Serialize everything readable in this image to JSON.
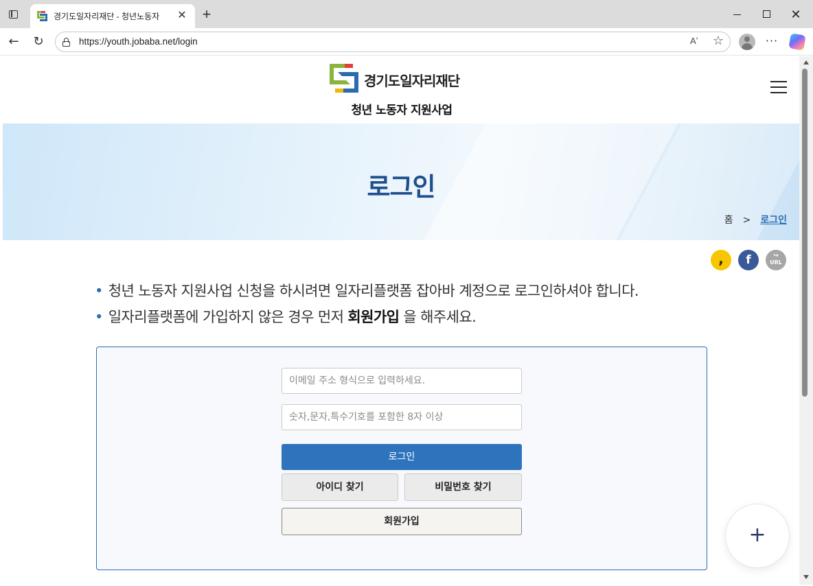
{
  "browser": {
    "tab_title": "경기도일자리재단 - 청년노동자",
    "tab_close": "✕",
    "new_tab": "+",
    "url": "https://youth.jobaba.net/login",
    "read_aloud": "Aʽ",
    "more": "···",
    "window_close": "✕"
  },
  "header": {
    "logo_text": "경기도일자리재단",
    "subtitle": "청년 노동자 지원사업"
  },
  "banner": {
    "title": "로그인",
    "breadcrumb": {
      "home": "홈",
      "separator": ">",
      "current": "로그인"
    }
  },
  "share": {
    "kakao": ",",
    "facebook": "f",
    "url": "URL"
  },
  "notices": {
    "line1": "청년 노동자 지원사업 신청을 하시려면 일자리플랫폼 잡아바 계정으로 로그인하셔야 합니다.",
    "line2_before": "일자리플랫폼에 가입하지 않은 경우 먼저 ",
    "line2_link": "회원가입",
    "line2_after": " 을 해주세요.",
    "bullet": "•"
  },
  "login_form": {
    "email_placeholder": "이메일 주소 형식으로 입력하세요.",
    "password_placeholder": "숫자,문자,특수기호를 포함한 8자 이상",
    "login_button": "로그인",
    "find_id_button": "아이디 찾기",
    "find_password_button": "비밀번호 찾기",
    "signup_button": "회원가입"
  },
  "fab": {
    "label": "+"
  },
  "colors": {
    "accent": "#2d74bd",
    "heading": "#1f4f8f",
    "kakao": "#f7c600",
    "facebook": "#3b5998"
  }
}
